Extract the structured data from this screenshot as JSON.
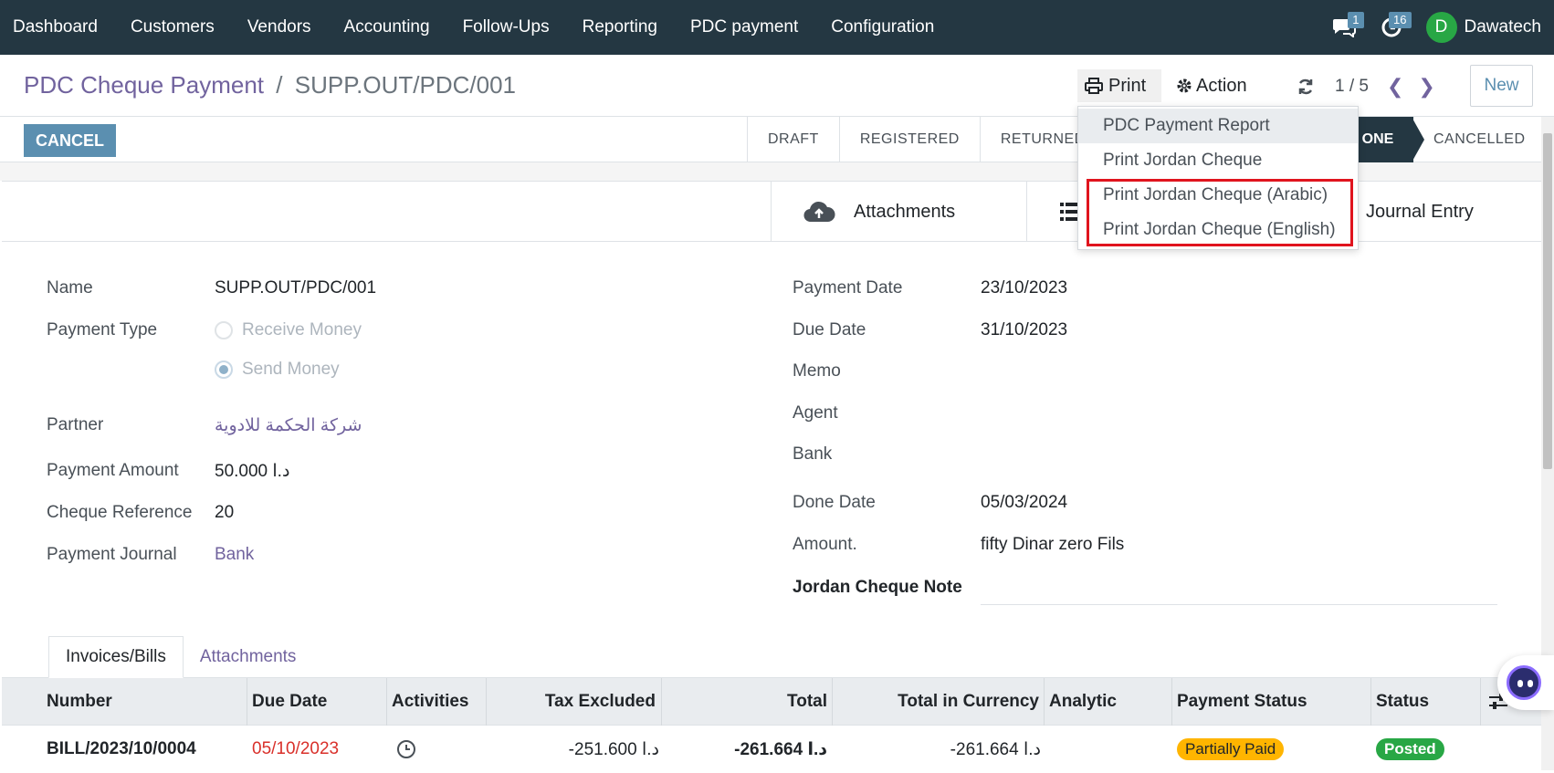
{
  "navbar": {
    "menu": [
      "Dashboard",
      "Customers",
      "Vendors",
      "Accounting",
      "Follow-Ups",
      "Reporting",
      "PDC payment",
      "Configuration"
    ],
    "messages_count": "1",
    "activities_count": "16",
    "avatar_letter": "D",
    "user_name": "Dawatech"
  },
  "control": {
    "breadcrumb_parent": "PDC Cheque Payment",
    "breadcrumb_sep": "/",
    "breadcrumb_current": "SUPP.OUT/PDC/001",
    "print_label": "Print",
    "action_label": "Action",
    "pager_value": "1 / 5",
    "new_label": "New"
  },
  "statusbar": {
    "cancel_label": "CANCEL",
    "stages": [
      "DRAFT",
      "REGISTERED",
      "RETURNED"
    ],
    "done_stage": "ONE",
    "cancelled_stage": "CANCELLED"
  },
  "buttonbox": {
    "attachments": "Attachments",
    "journal_entry": "Journal Entry"
  },
  "form": {
    "left": {
      "name_label": "Name",
      "name_value": "SUPP.OUT/PDC/001",
      "payment_type_label": "Payment Type",
      "receive_money": "Receive Money",
      "send_money": "Send Money",
      "partner_label": "Partner",
      "partner_value": "شركة الحكمة للادوية",
      "payment_amount_label": "Payment Amount",
      "payment_amount_value": "50.000  د.ا",
      "cheque_ref_label": "Cheque Reference",
      "cheque_ref_value": "20",
      "journal_label": "Payment Journal",
      "journal_value": "Bank"
    },
    "right": {
      "payment_date_label": "Payment Date",
      "payment_date_value": "23/10/2023",
      "due_date_label": "Due Date",
      "due_date_value": "31/10/2023",
      "memo_label": "Memo",
      "agent_label": "Agent",
      "bank_label": "Bank",
      "done_date_label": "Done Date",
      "done_date_value": "05/03/2024",
      "amount_label": "Amount.",
      "amount_value": "fifty Dinar zero Fils",
      "jordan_note_label": "Jordan Cheque Note"
    }
  },
  "tabs": [
    "Invoices/Bills",
    "Attachments"
  ],
  "table": {
    "headers": [
      "Number",
      "Due Date",
      "Activities",
      "Tax Excluded",
      "Total",
      "Total in Currency",
      "Analytic",
      "Payment Status",
      "Status"
    ],
    "row": {
      "number": "BILL/2023/10/0004",
      "due_date": "05/10/2023",
      "tax_excluded": "-251.600  د.ا",
      "total": "-261.664  د.ا",
      "total_currency": "-261.664  د.ا",
      "payment_status": "Partially Paid",
      "status": "Posted"
    }
  },
  "print_menu": [
    "PDC Payment Report",
    "Print Jordan Cheque",
    "Print Jordan Cheque (Arabic)",
    "Print Jordan Cheque (English)"
  ],
  "colors": {
    "navbar": "#243742",
    "accent": "#71639e",
    "button": "#5b8fb0",
    "highlight": "#e0141e"
  }
}
